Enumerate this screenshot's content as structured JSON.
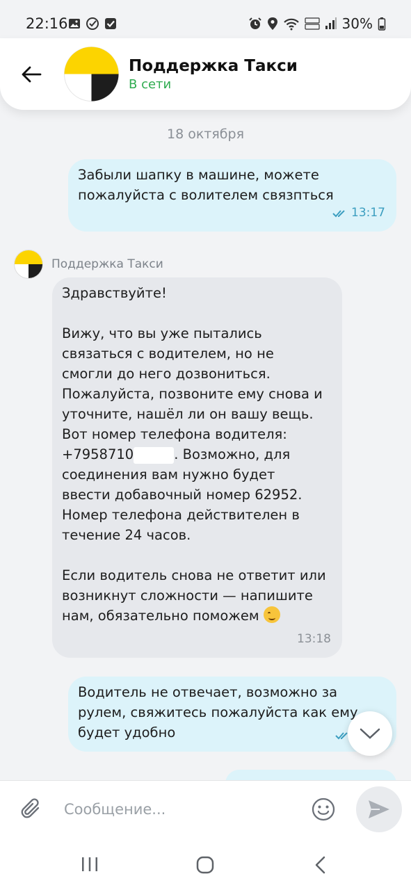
{
  "status_bar": {
    "time": "22:16",
    "battery": "30%",
    "icons": [
      "gallery-icon",
      "check-circle-icon",
      "checkbox-icon",
      "alarm-icon",
      "location-icon",
      "wifi-icon",
      "volte-lte-icon",
      "signal-icon",
      "battery-icon"
    ]
  },
  "header": {
    "title": "Поддержка Такси",
    "status": "В сети",
    "status_color": "#2eab4f"
  },
  "chat": {
    "date": "18 октября",
    "messages": [
      {
        "direction": "out",
        "text": "Забыли шапку в машине, можете\nпожалуйста с волителем связпться",
        "time": "13:17"
      },
      {
        "direction": "in",
        "sender": "Поддержка Такси",
        "text_a": "Здравствуйте!\n\nВижу, что вы уже пытались\nсвязаться с водителем, но не\nсмогли до него дозвониться.\nПожалуйста, позвоните ему снова и\nуточните, нашёл ли он вашу вещь.\nВот номер телефона водителя:\n+7958710",
        "text_b": ". Возможно, для\nсоединения вам нужно будет\nввести добавочный номер 62952.\nНомер телефона действителен в\nтечение 24 часов.\n\nЕсли водитель снова не ответит или\nвозникнут сложности — напишите\nнам, обязательно поможем ",
        "time": "13:18"
      },
      {
        "direction": "out",
        "text": "Водитель не отвечает, возможно за\nрулем, свяжитесь пожалуйста как ему\nбудет удобно"
      }
    ]
  },
  "composer": {
    "placeholder": "Сообщение..."
  },
  "colors": {
    "chat_bg": "#f2f3f5",
    "outgoing_bubble": "#dcf3fa",
    "incoming_bubble": "#e6e8ec",
    "time_out": "#3c9ec0",
    "brand_yellow": "#fcd400"
  }
}
